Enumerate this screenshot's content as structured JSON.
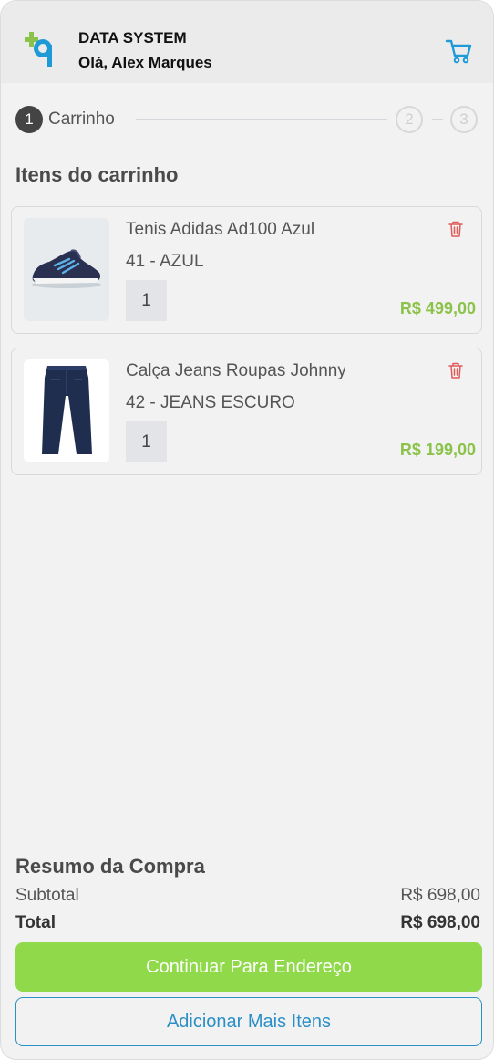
{
  "header": {
    "brand": "DATA SYSTEM",
    "greeting": "Olá, Alex Marques",
    "logo_icon": "data-system-logo",
    "cart_icon": "shopping-cart-icon"
  },
  "stepper": {
    "step1_number": "1",
    "step1_label": "Carrinho",
    "step2_number": "2",
    "step3_number": "3"
  },
  "cart": {
    "title": "Itens do carrinho",
    "items": [
      {
        "name": "Tenis Adidas Ad100 Azul",
        "variant": "41 - AZUL",
        "quantity": "1",
        "price": "R$ 499,00",
        "image_icon": "sneaker-image"
      },
      {
        "name": "Calça Jeans Roupas Johnny",
        "variant": "42 - JEANS ESCURO",
        "quantity": "1",
        "price": "R$ 199,00",
        "image_icon": "jeans-image"
      }
    ]
  },
  "summary": {
    "title": "Resumo da Compra",
    "subtotal_label": "Subtotal",
    "subtotal_value": "R$ 698,00",
    "total_label": "Total",
    "total_value": "R$ 698,00"
  },
  "actions": {
    "continue_label": "Continuar Para Endereço",
    "add_more_label": "Adicionar Mais Itens"
  },
  "colors": {
    "accent_green": "#8fd94a",
    "price_green": "#8bc34a",
    "accent_blue": "#2a8fc7",
    "delete_red": "#e05a5a"
  }
}
